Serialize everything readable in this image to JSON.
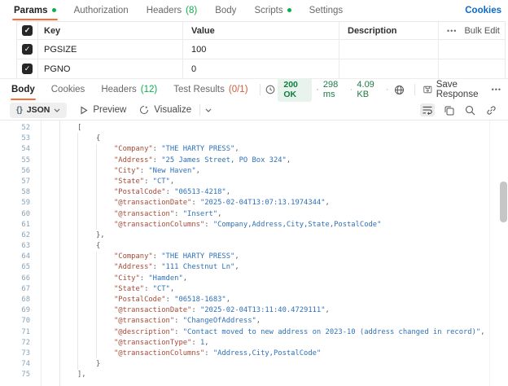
{
  "request_tabs": {
    "items": [
      {
        "label": "Params",
        "dot": true,
        "active": true
      },
      {
        "label": "Authorization"
      },
      {
        "label": "Headers",
        "badge": "(8)",
        "badge_color": "green"
      },
      {
        "label": "Body"
      },
      {
        "label": "Scripts",
        "dot": true
      },
      {
        "label": "Settings"
      }
    ],
    "cookies_link": "Cookies"
  },
  "params_table": {
    "columns": {
      "key": "Key",
      "value": "Value",
      "description": "Description"
    },
    "bulk_edit_label": "Bulk Edit",
    "more_icon": "•••",
    "rows": [
      {
        "key": "PGSIZE",
        "value": "100",
        "description": "",
        "checked": true
      },
      {
        "key": "PGNO",
        "value": "0",
        "description": "",
        "checked": true
      }
    ]
  },
  "response": {
    "tabs": [
      {
        "label": "Body",
        "active": true
      },
      {
        "label": "Cookies"
      },
      {
        "label": "Headers",
        "badge": "(12)",
        "badge_color": "green"
      },
      {
        "label": "Test Results",
        "badge": "(0/1)",
        "badge_color": "orange"
      }
    ],
    "status": "200 OK",
    "time": "298 ms",
    "size": "4.09 KB",
    "save_label": "Save Response",
    "more_icon": "•••"
  },
  "toolbar": {
    "format_braces": "{}",
    "format_label": "JSON",
    "preview_label": "Preview",
    "visualize_label": "Visualize"
  },
  "colors": {
    "accent_orange": "#ff6c37",
    "green": "#0caf49",
    "status_green": "#0e7e3e",
    "link_blue": "#0b6bcb",
    "json_key": "#a84a38",
    "json_value": "#2e71b8"
  },
  "code": {
    "lines": [
      {
        "n": 52,
        "lvl": 0,
        "bracket": "["
      },
      {
        "n": 53,
        "lvl": 1,
        "bracket": "{"
      },
      {
        "n": 54,
        "lvl": 2,
        "key": "Company",
        "value": "THE HARTY PRESS",
        "vtype": "string",
        "comma": true
      },
      {
        "n": 55,
        "lvl": 2,
        "key": "Address",
        "value": "25 James Street, PO Box 324",
        "vtype": "string",
        "comma": true
      },
      {
        "n": 56,
        "lvl": 2,
        "key": "City",
        "value": "New Haven",
        "vtype": "string",
        "comma": true
      },
      {
        "n": 57,
        "lvl": 2,
        "key": "State",
        "value": "CT",
        "vtype": "string",
        "comma": true
      },
      {
        "n": 58,
        "lvl": 2,
        "key": "PostalCode",
        "value": "06513-4218",
        "vtype": "string",
        "comma": true
      },
      {
        "n": 59,
        "lvl": 2,
        "key": "@transactionDate",
        "value": "2025-02-04T13:07:13.1974344",
        "vtype": "string",
        "comma": true
      },
      {
        "n": 60,
        "lvl": 2,
        "key": "@transaction",
        "value": "Insert",
        "vtype": "string",
        "comma": true
      },
      {
        "n": 61,
        "lvl": 2,
        "key": "@transactionColumns",
        "value": "Company,Address,City,State,PostalCode",
        "vtype": "string",
        "comma": false
      },
      {
        "n": 62,
        "lvl": 1,
        "bracket": "},"
      },
      {
        "n": 63,
        "lvl": 1,
        "bracket": "{"
      },
      {
        "n": 64,
        "lvl": 2,
        "key": "Company",
        "value": "THE HARTY PRESS",
        "vtype": "string",
        "comma": true
      },
      {
        "n": 65,
        "lvl": 2,
        "key": "Address",
        "value": "111 Chestnut Ln",
        "vtype": "string",
        "comma": true
      },
      {
        "n": 66,
        "lvl": 2,
        "key": "City",
        "value": "Hamden",
        "vtype": "string",
        "comma": true
      },
      {
        "n": 67,
        "lvl": 2,
        "key": "State",
        "value": "CT",
        "vtype": "string",
        "comma": true
      },
      {
        "n": 68,
        "lvl": 2,
        "key": "PostalCode",
        "value": "06518-1683",
        "vtype": "string",
        "comma": true
      },
      {
        "n": 69,
        "lvl": 2,
        "key": "@transactionDate",
        "value": "2025-02-04T13:11:40.4729111",
        "vtype": "string",
        "comma": true
      },
      {
        "n": 70,
        "lvl": 2,
        "key": "@transaction",
        "value": "ChangeOfAddress",
        "vtype": "string",
        "comma": true
      },
      {
        "n": 71,
        "lvl": 2,
        "key": "@description",
        "value": "Contact moved to new address on 2023-10 (address changed in record)",
        "vtype": "string",
        "comma": true
      },
      {
        "n": 72,
        "lvl": 2,
        "key": "@transactionType",
        "value": "1",
        "vtype": "number",
        "comma": true
      },
      {
        "n": 73,
        "lvl": 2,
        "key": "@transactionColumns",
        "value": "Address,City,PostalCode",
        "vtype": "string",
        "comma": false
      },
      {
        "n": 74,
        "lvl": 1,
        "bracket": "}"
      },
      {
        "n": 75,
        "lvl": 0,
        "bracket": "],"
      }
    ]
  }
}
